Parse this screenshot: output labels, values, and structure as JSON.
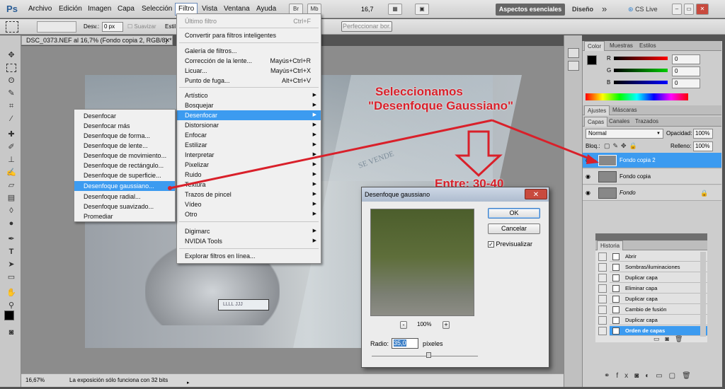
{
  "app": {
    "logo": "Ps"
  },
  "menubar": {
    "items": [
      "Archivo",
      "Edición",
      "Imagen",
      "Capa",
      "Selección",
      "Filtro",
      "Vista",
      "Ventana",
      "Ayuda"
    ],
    "bridge": "Br",
    "mini": "Mb",
    "zoom": "16,7",
    "workspace_active": "Aspectos esenciales",
    "workspace_other": "Diseño",
    "more": "»",
    "cslive": "CS Live"
  },
  "options": {
    "feather_label": "Desv.:",
    "feather_value": "0 px",
    "smooth_label": "Suavizar",
    "style_label": "Estil",
    "refine_button": "Perfeccionar bor."
  },
  "document": {
    "tab_title": "DSC_0373.NEF al 16,7% (Fondo copia 2, RGB/8) *",
    "zoom": "16,67%",
    "status": "La exposición sólo funciona con 32 bits",
    "plate": "LLLL JJJ",
    "sign": "SE VENDE"
  },
  "filter_menu": {
    "items": [
      {
        "label": "Último filtro",
        "shortcut": "Ctrl+F",
        "disabled": true
      },
      {
        "label": "Convertir para filtros inteligentes",
        "shortcut": ""
      },
      {
        "label": "Galería de filtros...",
        "shortcut": ""
      },
      {
        "label": "Corrección de la lente...",
        "shortcut": "Mayús+Ctrl+R"
      },
      {
        "label": "Licuar...",
        "shortcut": "Mayús+Ctrl+X"
      },
      {
        "label": "Punto de fuga...",
        "shortcut": "Alt+Ctrl+V"
      },
      {
        "label": "Artístico",
        "arrow": true
      },
      {
        "label": "Bosquejar",
        "arrow": true
      },
      {
        "label": "Desenfocar",
        "arrow": true,
        "selected": true
      },
      {
        "label": "Distorsionar",
        "arrow": true
      },
      {
        "label": "Enfocar",
        "arrow": true
      },
      {
        "label": "Estilizar",
        "arrow": true
      },
      {
        "label": "Interpretar",
        "arrow": true
      },
      {
        "label": "Pixelizar",
        "arrow": true
      },
      {
        "label": "Ruido",
        "arrow": true
      },
      {
        "label": "Textura",
        "arrow": true
      },
      {
        "label": "Trazos de pincel",
        "arrow": true
      },
      {
        "label": "Vídeo",
        "arrow": true
      },
      {
        "label": "Otro",
        "arrow": true
      },
      {
        "label": "Digimarc",
        "arrow": true
      },
      {
        "label": "NVIDIA Tools",
        "arrow": true
      },
      {
        "label": "Explorar filtros en línea..."
      }
    ]
  },
  "blur_submenu": {
    "items": [
      "Desenfocar",
      "Desenfocar más",
      "Desenfoque de forma...",
      "Desenfoque de lente...",
      "Desenfoque de movimiento...",
      "Desenfoque de rectángulo...",
      "Desenfoque de superficie...",
      "Desenfoque gaussiano...",
      "Desenfoque radial...",
      "Desenfoque suavizado...",
      "Promediar"
    ],
    "selected_index": 7
  },
  "annotations": {
    "line1": "Seleccionamos",
    "line2": "\"Desenfoque Gaussiano\"",
    "range": "Entre: 30-40",
    "color": "#d9202a"
  },
  "dialog": {
    "title": "Desenfoque gaussiano",
    "close": "✕",
    "ok": "OK",
    "cancel": "Cancelar",
    "preview_label": "Previsualizar",
    "zoom": "100%",
    "zoom_minus": "-",
    "zoom_plus": "+",
    "radius_label": "Radio:",
    "radius_value": "35,0",
    "radius_unit": "píxeles"
  },
  "color_panel": {
    "tabs": [
      "Color",
      "Muestras",
      "Estilos"
    ],
    "sliders": [
      {
        "label": "R",
        "value": "0"
      },
      {
        "label": "G",
        "value": "0"
      },
      {
        "label": "B",
        "value": "0"
      }
    ]
  },
  "adjust_panel": {
    "tabs": [
      "Ajustes",
      "Máscaras"
    ]
  },
  "layers_panel": {
    "tabs": [
      "Capas",
      "Canales",
      "Trazados"
    ],
    "blend_mode": "Normal",
    "opacity_label": "Opacidad:",
    "opacity_value": "100%",
    "lock_label": "Bloq.:",
    "fill_label": "Relleno:",
    "fill_value": "100%",
    "layers": [
      "Fondo copia 2",
      "Fondo copia",
      "Fondo"
    ]
  },
  "history_panel": {
    "title": "Historia",
    "items": [
      "Abrir",
      "Sombras/iluminaciones",
      "Duplicar capa",
      "Eliminar capa",
      "Duplicar capa",
      "Cambio de fusión",
      "Duplicar capa",
      "Orden de capas"
    ]
  }
}
